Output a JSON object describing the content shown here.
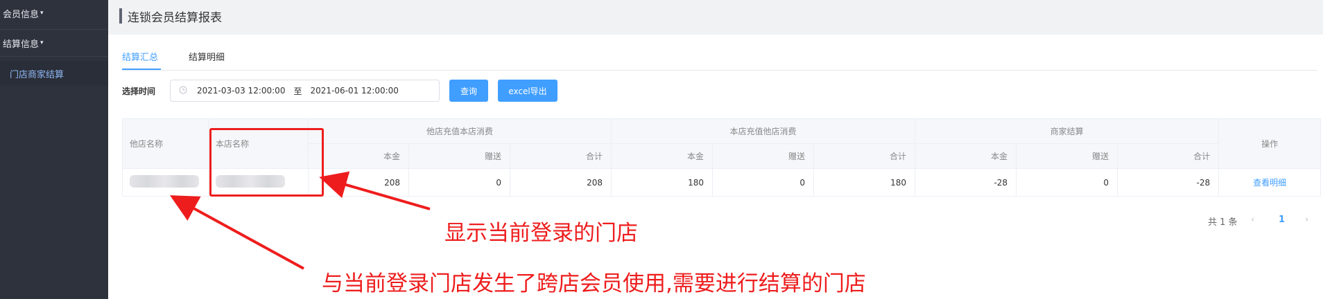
{
  "sidebar": {
    "items": [
      {
        "label": "会员信息",
        "caret": "▾"
      },
      {
        "label": "结算信息",
        "caret": "▾"
      },
      {
        "label": "门店商家结算"
      }
    ]
  },
  "header": {
    "title": "连锁会员结算报表"
  },
  "tabs": [
    {
      "label": "结算汇总",
      "active": true
    },
    {
      "label": "结算明细",
      "active": false
    }
  ],
  "filter": {
    "label": "选择时间",
    "start": "2021-03-03 12:00:00",
    "separator": "至",
    "end": "2021-06-01 12:00:00",
    "clock_icon": "clock-icon"
  },
  "buttons": {
    "query": "查询",
    "export": "excel导出"
  },
  "table": {
    "headers": {
      "other_store": "他店名称",
      "this_store": "本店名称",
      "group1": "他店充值本店消费",
      "group2": "本店充值他店消费",
      "group3": "商家结算",
      "action": "操作",
      "principal": "本金",
      "bonus": "赠送",
      "total": "合计"
    },
    "rows": [
      {
        "g1_principal": "208",
        "g1_bonus": "0",
        "g1_total": "208",
        "g2_principal": "180",
        "g2_bonus": "0",
        "g2_total": "180",
        "g3_principal": "-28",
        "g3_bonus": "0",
        "g3_total": "-28",
        "action": "查看明细"
      }
    ]
  },
  "pagination": {
    "total": "共 1 条",
    "prev": "‹",
    "page": "1",
    "next": "›"
  },
  "annotations": {
    "label1": "显示当前登录的门店",
    "label2": "与当前登录门店发生了跨店会员使用,需要进行结算的门店",
    "color": "#ee1d1d"
  },
  "colors": {
    "accent": "#409eff",
    "sidebar": "#2e323d"
  }
}
